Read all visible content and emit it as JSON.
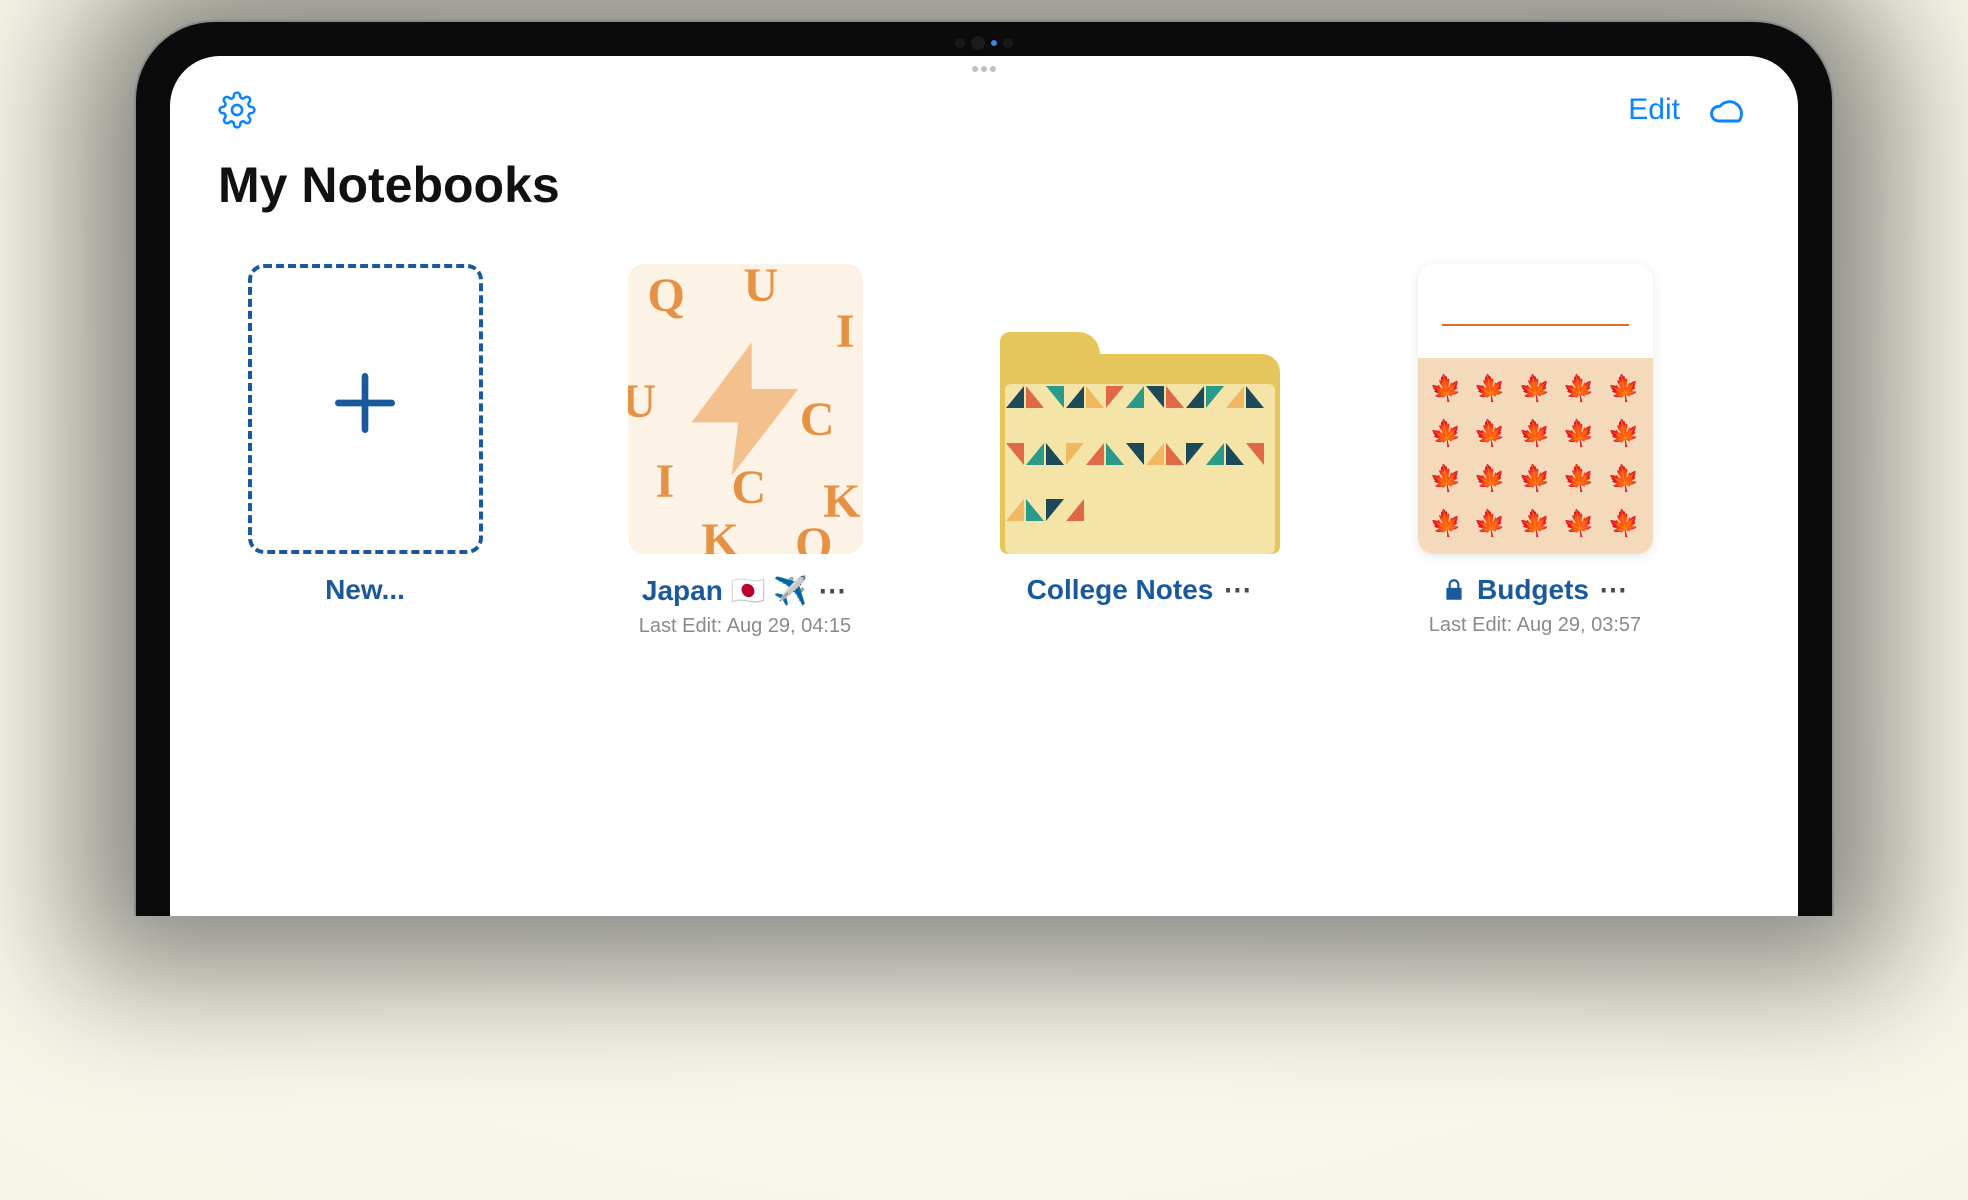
{
  "toolbar": {
    "edit_label": "Edit"
  },
  "page_title": "My Notebooks",
  "new_card": {
    "label": "New..."
  },
  "notebooks": [
    {
      "title": "Japan 🇯🇵 ✈️",
      "subtitle": "Last Edit: Aug 29, 04:15"
    },
    {
      "title": "College Notes",
      "subtitle": ""
    },
    {
      "title": "Budgets",
      "subtitle": "Last Edit: Aug 29, 03:57",
      "locked": true
    }
  ],
  "more_glyph": "⋯"
}
